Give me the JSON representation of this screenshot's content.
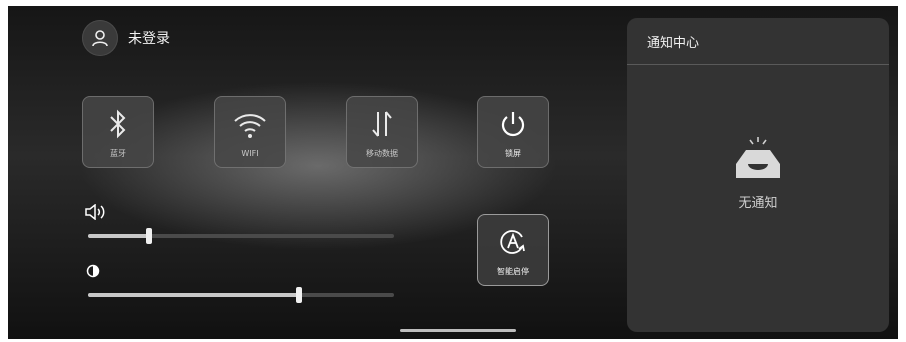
{
  "user": {
    "label": "未登录",
    "icon": "user-icon"
  },
  "quick_tiles": [
    {
      "label": "蓝牙",
      "icon": "bluetooth-icon"
    },
    {
      "label": "WIFI",
      "icon": "wifi-icon"
    },
    {
      "label": "移动数据",
      "icon": "mobile-data-icon"
    },
    {
      "label": "锁屏",
      "icon": "power-icon"
    },
    {
      "label": "智能启停",
      "icon": "auto-start-stop-icon"
    }
  ],
  "sliders": {
    "volume": {
      "icon": "volume-icon",
      "level": 0.2
    },
    "brightness": {
      "icon": "brightness-icon",
      "level": 0.69
    }
  },
  "notification_center": {
    "title": "通知中心",
    "empty_text": "无通知",
    "empty_icon": "empty-tray-icon"
  },
  "colors": {
    "panel": "#333333",
    "tile": "#464646",
    "accent": "#f0f0f0"
  }
}
